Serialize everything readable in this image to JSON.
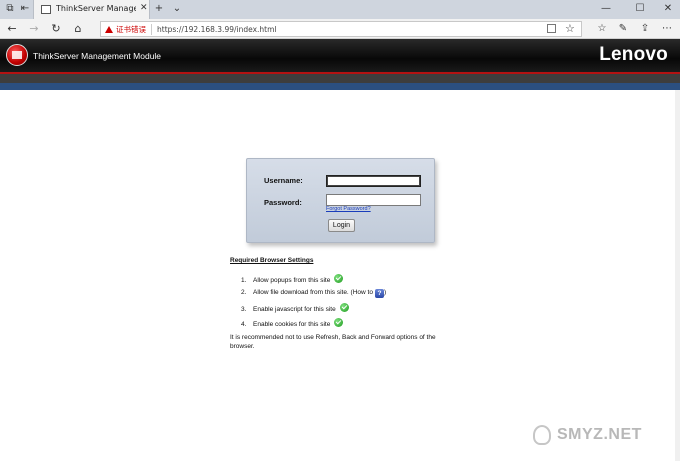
{
  "browser": {
    "tab_title": "ThinkServer Manageme",
    "cert_warning": "证书错误",
    "url": "https://192.168.3.99/index.html"
  },
  "app": {
    "title": "ThinkServer Management Module",
    "brand": "Lenovo"
  },
  "login": {
    "username_label": "Username:",
    "password_label": "Password:",
    "username_value": "",
    "password_value": "",
    "forgot_link": "Forgot Password?",
    "login_button": "Login"
  },
  "requirements": {
    "heading": "Required Browser Settings",
    "items": [
      {
        "num": "1.",
        "text": "Allow popups from this site",
        "icon": "check-icon"
      },
      {
        "num": "2.",
        "text": "Allow file download from this site. (How to",
        "suffix": ")",
        "icon": "help-icon"
      },
      {
        "num": "3.",
        "text": "Enable javascript for this site",
        "icon": "check-icon"
      },
      {
        "num": "4.",
        "text": "Enable cookies for this site",
        "icon": "check-icon"
      }
    ],
    "help_glyph": "?",
    "note": "It is recommended not to use Refresh, Back and Forward options of the browser."
  },
  "watermark": "SMYZ.NET",
  "colors": {
    "header_bg": "#0b0b0b",
    "accent_red": "#b31212",
    "accent_blue": "#2b4f80",
    "panel_bg": "#cfd7e3",
    "link": "#1a3dbb"
  }
}
